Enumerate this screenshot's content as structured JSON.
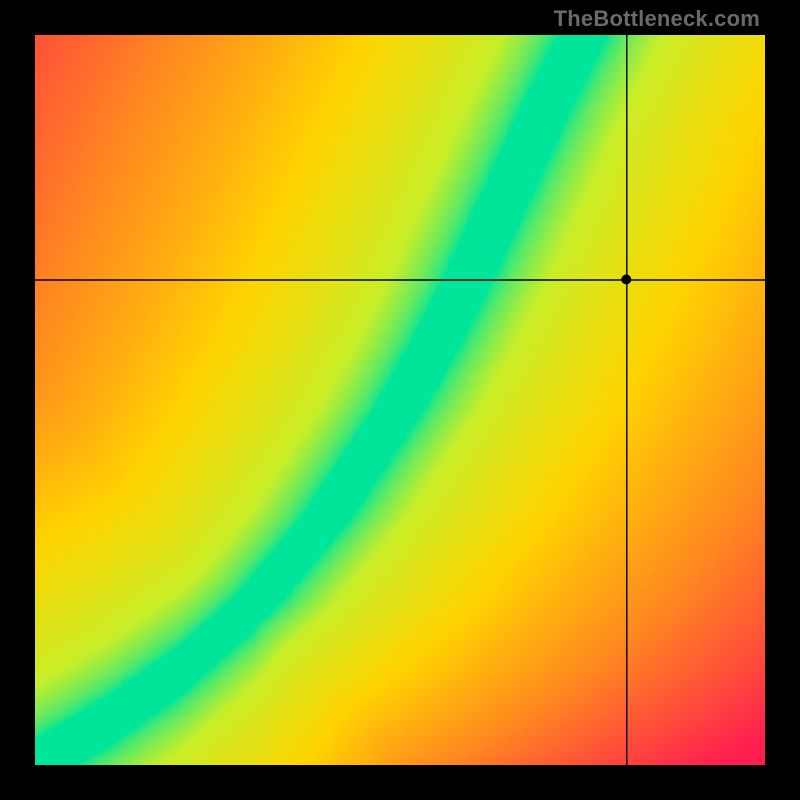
{
  "watermark": "TheBottleneck.com",
  "chart_data": {
    "type": "heatmap",
    "title": "",
    "xlabel": "",
    "ylabel": "",
    "xlim": [
      0,
      1
    ],
    "ylim": [
      0,
      1
    ],
    "marker": {
      "x": 0.81,
      "y": 0.665,
      "color": "#000000"
    },
    "crosshair": {
      "x": 0.81,
      "y": 0.665,
      "color": "#000000"
    },
    "optimal_curve": {
      "description": "green optimal ratio band, concave-up curve from bottom-left to upper-right",
      "points_xy": [
        [
          0.0,
          0.0
        ],
        [
          0.1,
          0.06
        ],
        [
          0.2,
          0.13
        ],
        [
          0.3,
          0.22
        ],
        [
          0.4,
          0.34
        ],
        [
          0.5,
          0.49
        ],
        [
          0.55,
          0.58
        ],
        [
          0.6,
          0.68
        ],
        [
          0.65,
          0.79
        ],
        [
          0.7,
          0.9
        ],
        [
          0.75,
          1.0
        ]
      ],
      "band_half_width": 0.035
    },
    "color_stops": [
      {
        "t": 0.0,
        "color": "#00e59a"
      },
      {
        "t": 0.2,
        "color": "#c8ee28"
      },
      {
        "t": 0.45,
        "color": "#ffd400"
      },
      {
        "t": 0.7,
        "color": "#ff8a1f"
      },
      {
        "t": 1.0,
        "color": "#ff1f4f"
      }
    ],
    "grid_resolution": 256
  }
}
